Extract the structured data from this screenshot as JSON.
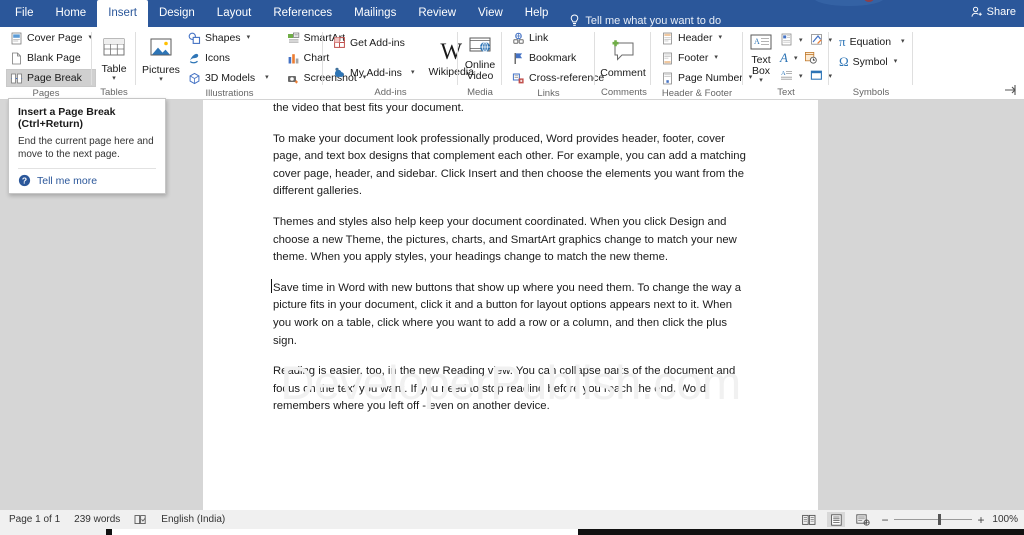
{
  "window": {
    "tabs": [
      {
        "label": "File",
        "active": false
      },
      {
        "label": "Home",
        "active": false
      },
      {
        "label": "Insert",
        "active": true
      },
      {
        "label": "Design",
        "active": false
      },
      {
        "label": "Layout",
        "active": false
      },
      {
        "label": "References",
        "active": false
      },
      {
        "label": "Mailings",
        "active": false
      },
      {
        "label": "Review",
        "active": false
      },
      {
        "label": "View",
        "active": false
      },
      {
        "label": "Help",
        "active": false
      }
    ],
    "tell_me": "Tell me what you want to do",
    "tell_me_icon": "lightbulb-icon",
    "share_label": "Share",
    "share_icon": "person-share-icon",
    "accent_color": "#2b579a"
  },
  "ribbon": {
    "collapse_icon": "collapse-ribbon-icon",
    "groups": [
      {
        "name": "Pages",
        "label": "Pages",
        "items": [
          {
            "label": "Cover Page",
            "icon": "cover-page-icon",
            "dropdown": true,
            "hover": false
          },
          {
            "label": "Blank Page",
            "icon": "blank-page-icon",
            "dropdown": false,
            "hover": false
          },
          {
            "label": "Page Break",
            "icon": "page-break-icon",
            "dropdown": false,
            "hover": true
          }
        ]
      },
      {
        "name": "Tables",
        "label": "Tables",
        "items": [
          {
            "label": "Table",
            "icon": "table-icon",
            "dropdown": true,
            "big": true
          }
        ]
      },
      {
        "name": "Illustrations",
        "label": "Illustrations",
        "items": [
          {
            "label": "Pictures",
            "icon": "pictures-icon",
            "dropdown": true,
            "big": true
          },
          {
            "label": "Shapes",
            "icon": "shapes-icon",
            "dropdown": true
          },
          {
            "label": "Icons",
            "icon": "icons-icon",
            "dropdown": false
          },
          {
            "label": "3D Models",
            "icon": "3d-models-icon",
            "dropdown": true
          },
          {
            "label": "SmartArt",
            "icon": "smartart-icon",
            "dropdown": false
          },
          {
            "label": "Chart",
            "icon": "chart-icon",
            "dropdown": false
          },
          {
            "label": "Screenshot",
            "icon": "screenshot-icon",
            "dropdown": true
          }
        ]
      },
      {
        "name": "Add-ins",
        "label": "Add-ins",
        "items": [
          {
            "label": "Get Add-ins",
            "icon": "get-addins-icon",
            "dropdown": false
          },
          {
            "label": "My Add-ins",
            "icon": "my-addins-icon",
            "dropdown": true
          },
          {
            "label": "Wikipedia",
            "icon": "wikipedia-icon",
            "big": true
          }
        ]
      },
      {
        "name": "Media",
        "label": "Media",
        "items": [
          {
            "label": "Online Video",
            "icon": "online-video-icon",
            "big": true
          }
        ]
      },
      {
        "name": "Links",
        "label": "Links",
        "items": [
          {
            "label": "Link",
            "icon": "link-icon",
            "dropdown": false
          },
          {
            "label": "Bookmark",
            "icon": "bookmark-icon",
            "dropdown": false
          },
          {
            "label": "Cross-reference",
            "icon": "cross-reference-icon",
            "dropdown": false
          }
        ]
      },
      {
        "name": "Comments",
        "label": "Comments",
        "items": [
          {
            "label": "Comment",
            "icon": "new-comment-icon",
            "big": true
          }
        ]
      },
      {
        "name": "Header & Footer",
        "label": "Header & Footer",
        "items": [
          {
            "label": "Header",
            "icon": "header-icon",
            "dropdown": true
          },
          {
            "label": "Footer",
            "icon": "footer-icon",
            "dropdown": true
          },
          {
            "label": "Page Number",
            "icon": "page-number-icon",
            "dropdown": true
          }
        ]
      },
      {
        "name": "Text",
        "label": "Text",
        "items": [
          {
            "label": "Text Box",
            "icon": "text-box-icon",
            "dropdown": true,
            "big": true
          },
          {
            "label": "",
            "icon": "quick-parts-icon",
            "dropdown": true
          },
          {
            "label": "",
            "icon": "wordart-icon",
            "dropdown": true
          },
          {
            "label": "",
            "icon": "drop-cap-icon",
            "dropdown": true
          },
          {
            "label": "",
            "icon": "signature-line-icon",
            "dropdown": true
          },
          {
            "label": "",
            "icon": "date-time-icon",
            "dropdown": false
          },
          {
            "label": "",
            "icon": "object-icon",
            "dropdown": true
          }
        ]
      },
      {
        "name": "Symbols",
        "label": "Symbols",
        "items": [
          {
            "label": "Equation",
            "icon": "equation-icon",
            "dropdown": true
          },
          {
            "label": "Symbol",
            "icon": "symbol-icon",
            "dropdown": true
          }
        ]
      }
    ]
  },
  "tooltip": {
    "title": "Insert a Page Break (Ctrl+Return)",
    "body": "End the current page here and move to the next page.",
    "more_label": "Tell me more",
    "more_icon": "help-circle-icon"
  },
  "document": {
    "paragraphs": [
      "the video that best fits your document.",
      "To make your document look professionally produced, Word provides header, footer, cover page, and text box designs that complement each other. For example, you can add a matching cover page, header, and sidebar. Click Insert and then choose the elements you want from the different galleries.",
      "Themes and styles also help keep your document coordinated. When you click Design and choose a new Theme, the pictures, charts, and SmartArt graphics change to match your new theme. When you apply styles, your headings change to match the new theme.",
      "Save time in Word with new buttons that show up where you need them. To change the way a picture fits in your document, click it and a button for layout options appears next to it. When you work on a table, click where you want to add a row or a column, and then click the plus sign.",
      "Reading is easier, too, in the new Reading view. You can collapse parts of the document and focus on the text you want. If you need to stop reading before you reach the end, Word remembers where you left off - even on another device."
    ],
    "watermark": "DeveloperPublish.com"
  },
  "statusbar": {
    "page": "Page 1 of 1",
    "words": "239 words",
    "proofing_icon": "proofing-errors-icon",
    "language": "English (India)",
    "views": [
      {
        "icon": "read-mode-icon",
        "active": false
      },
      {
        "icon": "print-layout-icon",
        "active": true
      },
      {
        "icon": "web-layout-icon",
        "active": false
      }
    ],
    "zoom_out": "−",
    "zoom_in": "+",
    "zoom_level": "100%"
  }
}
